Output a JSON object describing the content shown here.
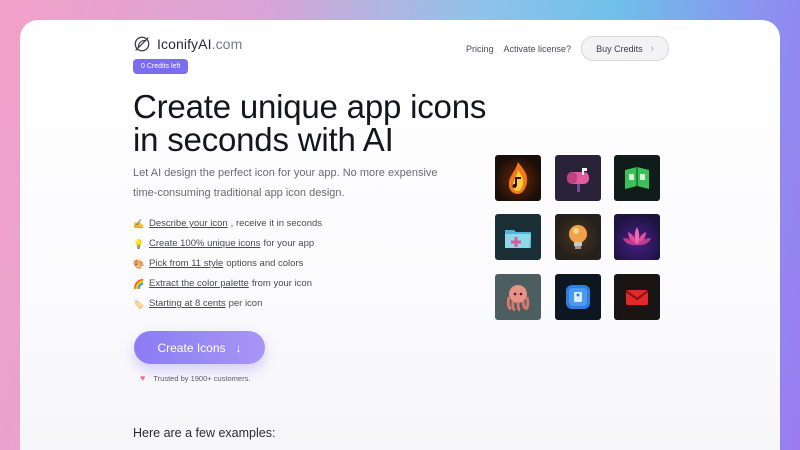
{
  "brand": {
    "name": "IconifyAI",
    "domain": ".com"
  },
  "credits_badge": "0 Credits left",
  "nav": {
    "pricing": "Pricing",
    "activate": "Activate license?",
    "buy": "Buy Credits"
  },
  "hero": {
    "headline_line1": "Create unique app icons",
    "headline_line2": "in seconds with AI",
    "subtext": "Let AI design the perfect icon for your app. No more expensive time-consuming traditional app icon design."
  },
  "features": [
    {
      "emoji": "✍️",
      "link": "Describe your icon",
      "rest": ", receive it in seconds"
    },
    {
      "emoji": "💡",
      "link": "Create 100% unique icons",
      "rest": " for your app"
    },
    {
      "emoji": "🎨",
      "link": "Pick from 11 style",
      "rest": " options and colors"
    },
    {
      "emoji": "🌈",
      "link": "Extract the color palette",
      "rest": " from your icon"
    },
    {
      "emoji": "🏷️",
      "link": "Starting at 8 cents",
      "rest": " per icon"
    }
  ],
  "cta": {
    "label": "Create Icons"
  },
  "trusted": "Trusted by 1900+ customers.",
  "examples_heading": "Here are a few examples:",
  "icons": [
    {
      "name": "music-flame-icon",
      "bg": "#1a0e08"
    },
    {
      "name": "mailbox-icon",
      "bg": "#2a2238"
    },
    {
      "name": "green-book-icon",
      "bg": "#101c1a"
    },
    {
      "name": "folder-plus-icon",
      "bg": "#1a3036"
    },
    {
      "name": "lightbulb-icon",
      "bg": "#24201c"
    },
    {
      "name": "lotus-icon",
      "bg": "#1d1440"
    },
    {
      "name": "pink-octopus-icon",
      "bg": "#4d5e60"
    },
    {
      "name": "blue-app-icon",
      "bg": "#0c1722"
    },
    {
      "name": "red-envelope-icon",
      "bg": "#1a1414"
    }
  ]
}
